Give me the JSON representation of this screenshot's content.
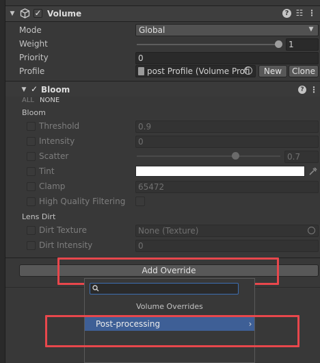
{
  "volume": {
    "title": "Volume",
    "mode_label": "Mode",
    "mode_value": "Global",
    "weight_label": "Weight",
    "weight_value": "1",
    "weight_fraction": 1.0,
    "priority_label": "Priority",
    "priority_value": "0",
    "profile_label": "Profile",
    "profile_value": "post Profile (Volume Profi",
    "new_label": "New",
    "clone_label": "Clone"
  },
  "bloom": {
    "title": "Bloom",
    "all_label": "ALL",
    "none_label": "NONE",
    "section_bloom": "Bloom",
    "threshold_label": "Threshold",
    "threshold_value": "0.9",
    "intensity_label": "Intensity",
    "intensity_value": "0",
    "scatter_label": "Scatter",
    "scatter_value": "0.7",
    "scatter_fraction": 0.7,
    "tint_label": "Tint",
    "tint_color": "#ffffff",
    "clamp_label": "Clamp",
    "clamp_value": "65472",
    "hq_label": "High Quality Filtering",
    "section_lens": "Lens Dirt",
    "dirt_texture_label": "Dirt Texture",
    "dirt_texture_value": "None (Texture)",
    "dirt_intensity_label": "Dirt Intensity",
    "dirt_intensity_value": "0"
  },
  "add_override_label": "Add Override",
  "popup": {
    "search_value": "",
    "title": "Volume Overrides",
    "item_label": "Post-processing"
  },
  "colors": {
    "highlight": "#e8474c",
    "selected_item": "#3e5f96"
  }
}
